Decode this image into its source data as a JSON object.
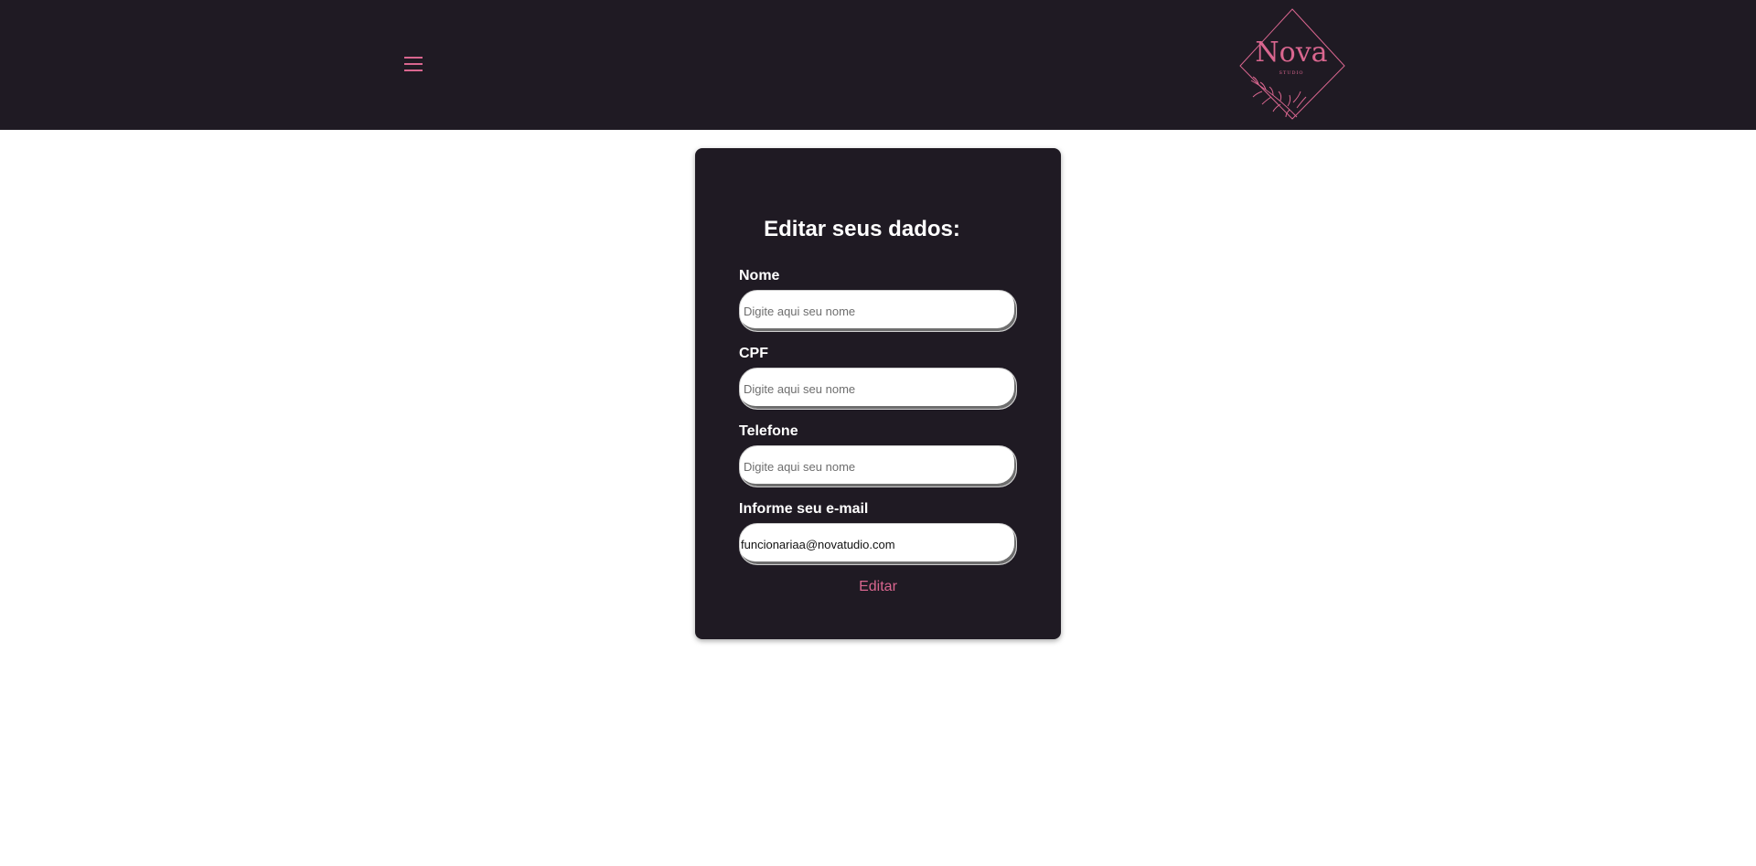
{
  "header": {
    "menu_icon": "hamburger-menu-icon",
    "logo": {
      "text": "Nova",
      "subtext": "STUDIO",
      "accent_color": "#d9668f"
    },
    "background_color": "#1f1a23"
  },
  "form": {
    "title": "Editar seus dados:",
    "fields": [
      {
        "label": "Nome",
        "placeholder": "Digite aqui seu nome",
        "value": ""
      },
      {
        "label": "CPF",
        "placeholder": "Digite aqui seu nome",
        "value": ""
      },
      {
        "label": "Telefone",
        "placeholder": "Digite aqui seu nome",
        "value": ""
      },
      {
        "label": "Informe seu e-mail",
        "placeholder": "",
        "value": "funcionariaa@novatudio.com"
      }
    ],
    "submit_label": "Editar"
  }
}
